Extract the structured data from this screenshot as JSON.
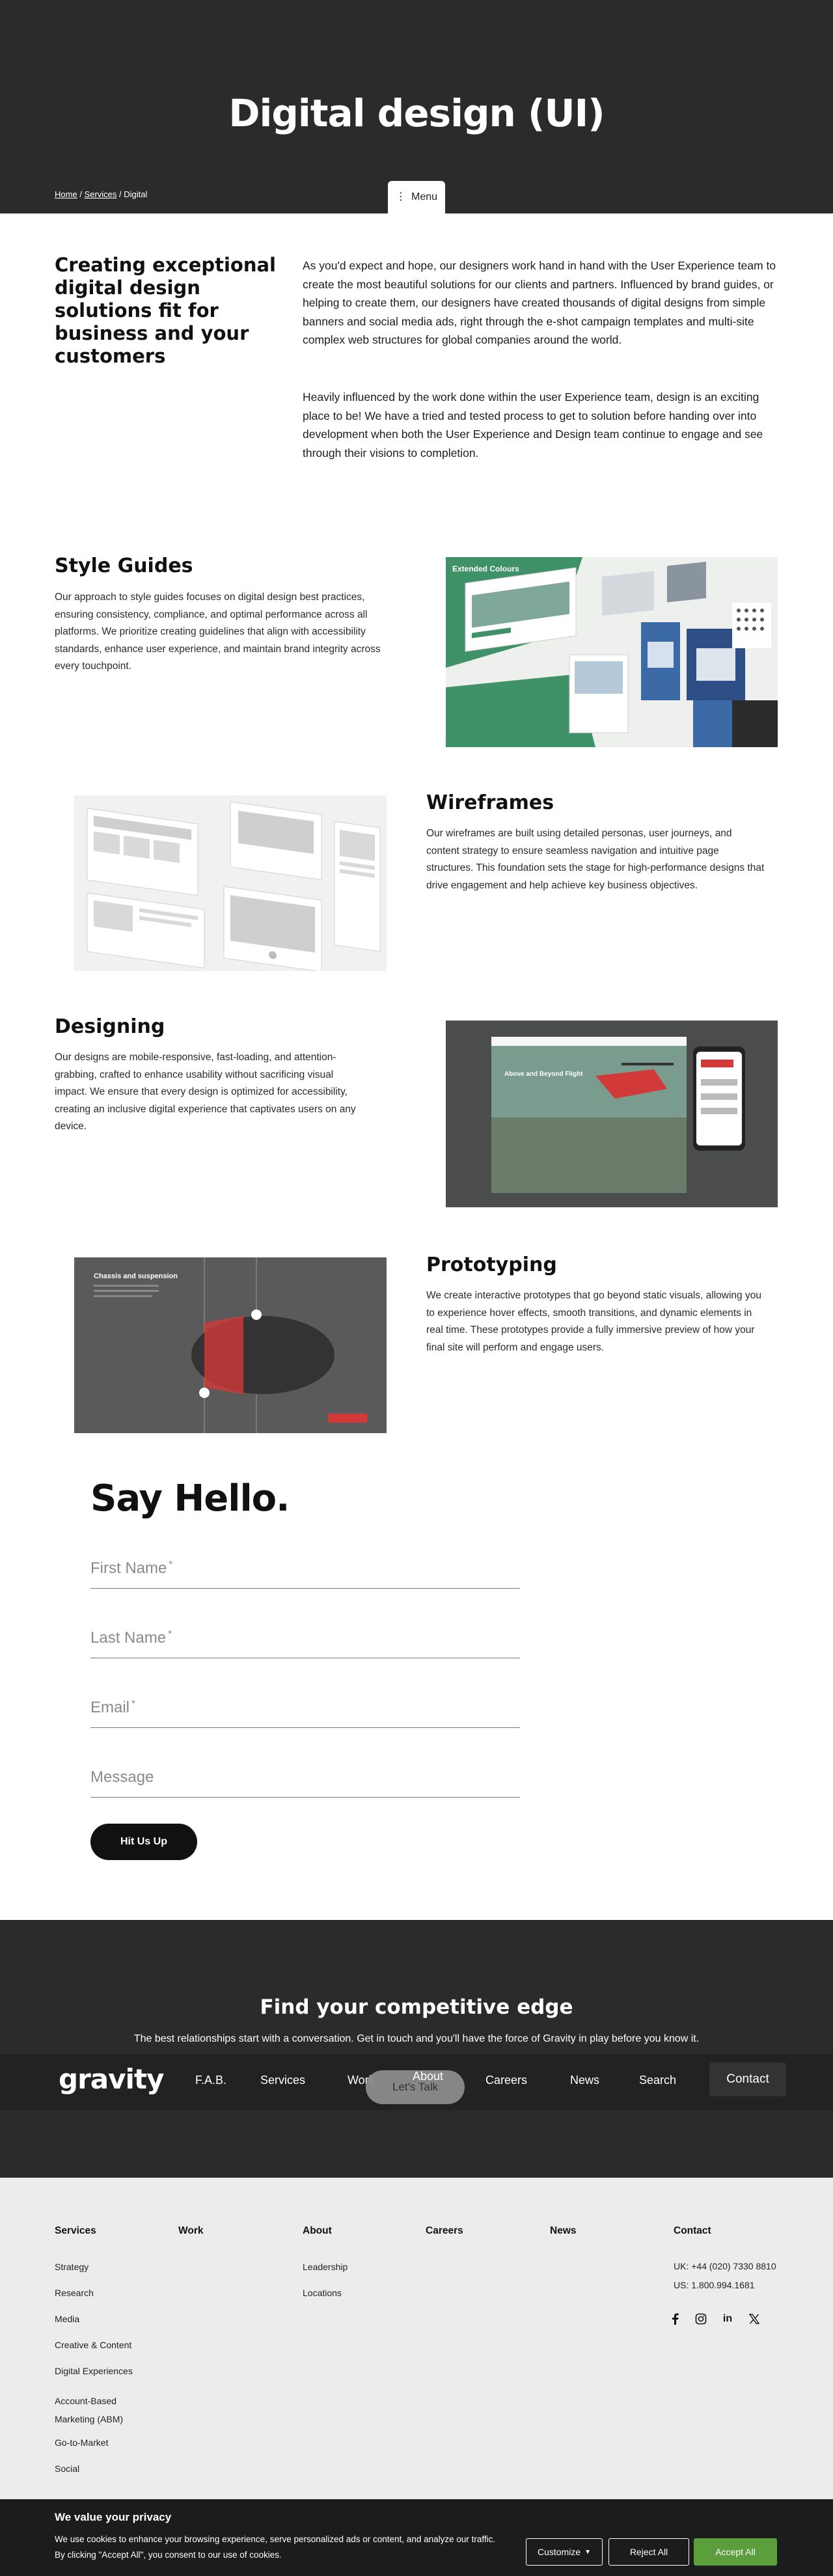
{
  "hero": {
    "title": "Digital design (UI)",
    "breadcrumb": [
      "Home",
      "Services",
      "Digital"
    ],
    "menu_label": "Menu"
  },
  "intro": {
    "heading": "Creating exceptional digital design solutions fit for business and your customers",
    "paragraphs": [
      "As you'd expect and hope, our designers work hand in hand with the User Experience team to create the most beautiful solutions for our clients and partners. Influenced by brand guides, or helping to create them, our designers have created thousands of digital designs from simple banners and social media ads, right through the e-shot campaign templates and multi-site complex web structures for global companies around the world.",
      "Heavily influenced by the work done within the user Experience team, design is an exciting place to be! We have a tried and tested process to get to solution before handing over into development when both the User Experience and Design team continue to engage and see through their visions to completion."
    ]
  },
  "sections": [
    {
      "title": "Style Guides",
      "text": "Our approach to style guides focuses on digital design best practices, ensuring consistency, compliance, and optimal performance across all platforms. We prioritize creating guidelines that align with accessibility standards, enhance user experience, and maintain brand integrity across every touchpoint.",
      "image_label": "Extended Colours"
    },
    {
      "title": "Wireframes",
      "text": "Our wireframes are built using detailed personas, user journeys, and content strategy to ensure seamless navigation and intuitive page structures. This foundation sets the stage for high-performance designs that drive engagement and help achieve key business objectives."
    },
    {
      "title": "Designing",
      "text": "Our designs are mobile-responsive, fast-loading, and attention-grabbing, crafted to enhance usability without sacrificing visual impact. We ensure that every design is optimized for accessibility, creating an inclusive digital experience that captivates users on any device.",
      "image_label": "Above and Beyond Flight"
    },
    {
      "title": "Prototyping",
      "text": "We create interactive prototypes that go beyond static visuals, allowing you to experience hover effects, smooth transitions, and dynamic elements in real time. These prototypes provide a fully immersive preview of how your final site will perform and engage users.",
      "image_label": "Chassis and suspension"
    }
  ],
  "contact_form": {
    "heading": "Say Hello.",
    "fields": [
      {
        "label": "First Name",
        "required": true
      },
      {
        "label": "Last Name",
        "required": true
      },
      {
        "label": "Email",
        "required": true
      },
      {
        "label": "Message",
        "required": false
      }
    ],
    "submit_label": "Hit Us Up"
  },
  "cta": {
    "heading": "Find your competitive edge",
    "text": "The best relationships start with a conversation. Get in touch and you'll have the force of Gravity in play before you know it.",
    "button_label": "Let's Talk"
  },
  "navbar": {
    "logo": "gravity",
    "items": [
      "F.A.B.",
      "Services",
      "Work",
      "About",
      "Careers",
      "News",
      "Search"
    ],
    "contact_label": "Contact"
  },
  "footer": {
    "columns": [
      {
        "title": "Services",
        "links": [
          "Strategy",
          "Research",
          "Media",
          "Creative & Content",
          "Digital Experiences",
          "Account-Based Marketing (ABM)",
          "Go-to-Market",
          "Social"
        ]
      },
      {
        "title": "Work",
        "links": []
      },
      {
        "title": "About",
        "links": [
          "Leadership",
          "Locations"
        ]
      },
      {
        "title": "Careers",
        "links": []
      },
      {
        "title": "News",
        "links": []
      },
      {
        "title": "Contact",
        "links": [
          "UK: +44 (020) 7330 8810",
          "US: 1.800.994.1681"
        ]
      }
    ],
    "social_icons": [
      "facebook-icon",
      "instagram-icon",
      "linkedin-icon",
      "x-icon"
    ]
  },
  "cookie_banner": {
    "title": "We value your privacy",
    "text": "We use cookies to enhance your browsing experience, serve personalized ads or content, and analyze our traffic. By clicking \"Accept All\", you consent to our use of cookies.",
    "customize_label": "Customize",
    "reject_label": "Reject All",
    "accept_label": "Accept All"
  },
  "colors": {
    "dark_bg": "#2b2b2b",
    "navbar_bg": "#222222",
    "footer_bg": "#ececec",
    "accept_green": "#5c9e3c",
    "accent_red": "#d23a3a",
    "style_green": "#3f9167"
  }
}
